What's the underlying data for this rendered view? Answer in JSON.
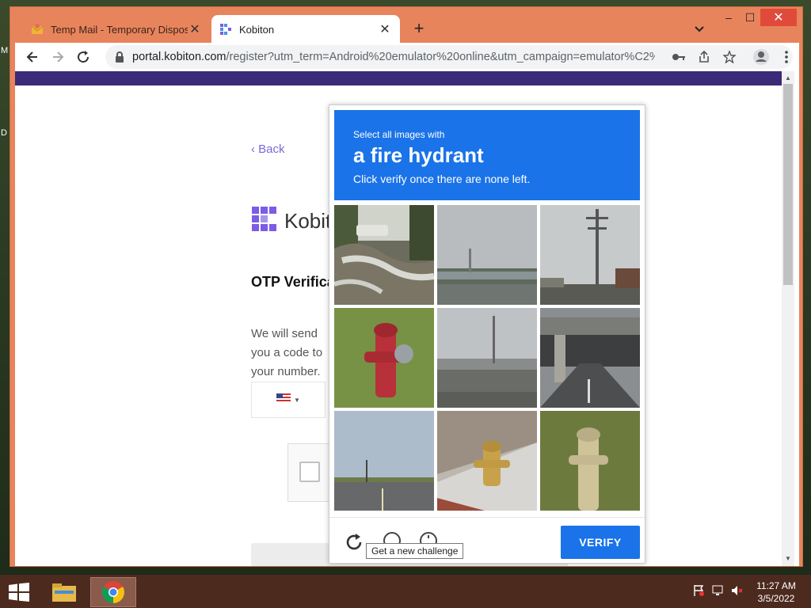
{
  "browser": {
    "tabs": [
      {
        "title": "Temp Mail - Temporary Disposab",
        "active": false
      },
      {
        "title": "Kobiton",
        "active": true
      }
    ],
    "new_tab_label": "+",
    "address": {
      "host": "portal.kobiton.com",
      "path": "/register?utm_term=Android%20emulator%20online&utm_campaign=emulator%C2%..."
    },
    "window_controls": {
      "minimize": "–",
      "maximize": "☐",
      "close": "✕"
    }
  },
  "page": {
    "back_label": "‹ Back",
    "brand_name": "Kobiton",
    "otp_title": "OTP Verification",
    "otp_desc": "We will send you a code to your number.",
    "colors": {
      "purple_bar": "#3a2a78",
      "brand_purple": "#7c5ce6"
    }
  },
  "challenge": {
    "instruction_line1": "Select all images with",
    "instruction_target": "a fire hydrant",
    "instruction_line3": "Click verify once there are none left.",
    "tiles": [
      {
        "label": "snowy yard with car"
      },
      {
        "label": "overpass highway"
      },
      {
        "label": "utility pole street"
      },
      {
        "label": "fire hydrant in grass"
      },
      {
        "label": "highway overpass wide"
      },
      {
        "label": "road under bridge"
      },
      {
        "label": "intersection road"
      },
      {
        "label": "hydrant on sidewalk"
      },
      {
        "label": "hydrant in field"
      }
    ],
    "tooltip": "Get a new challenge",
    "verify_label": "VERIFY",
    "accent": "#1a73e8"
  },
  "taskbar": {
    "time": "11:27 AM",
    "date": "3/5/2022"
  }
}
